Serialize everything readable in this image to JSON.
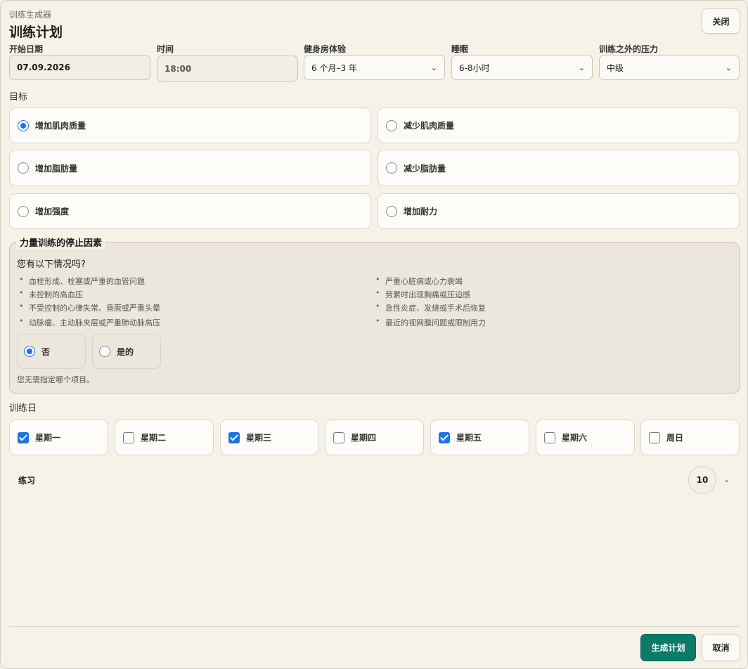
{
  "header": {
    "app_name": "训练生成器",
    "title": "训练计划",
    "close_label": "关闭"
  },
  "fields": {
    "start_date": {
      "label": "开始日期",
      "value": "07.09.2026"
    },
    "time": {
      "label": "时间",
      "value": "18:00"
    },
    "gym_experience": {
      "label": "健身房体验",
      "value": "6 个月–3 年"
    },
    "sleep": {
      "label": "睡眠",
      "value": "6-8小时"
    },
    "stress": {
      "label": "训练之外的压力",
      "value": "中级"
    }
  },
  "goals": {
    "label": "目标",
    "options": [
      {
        "label": "增加肌肉质量",
        "selected": true
      },
      {
        "label": "减少肌肉质量",
        "selected": false
      },
      {
        "label": "增加脂肪量",
        "selected": false
      },
      {
        "label": "减少脂肪量",
        "selected": false
      },
      {
        "label": "增加强度",
        "selected": false
      },
      {
        "label": "增加耐力",
        "selected": false
      }
    ]
  },
  "stop_factors": {
    "legend": "力量训练的停止因素",
    "question": "您有以下情况吗?",
    "conditions_left": [
      "血栓形成、栓塞或严重的血管问题",
      "未控制的高血压",
      "不受控制的心律失常、昏厥或严重头晕",
      "动脉瘤、主动脉夹层或严重肺动脉高压"
    ],
    "conditions_right": [
      "严重心脏病或心力衰竭",
      "劳累时出现胸痛或压迫感",
      "急性炎症、发烧或手术后恢复",
      "最近的视网膜问题或限制用力"
    ],
    "no_label": "否",
    "yes_label": "是的",
    "selected": "no",
    "hint": "您无需指定哪个项目。"
  },
  "training_days": {
    "label": "训练日",
    "days": [
      {
        "label": "星期一",
        "checked": true
      },
      {
        "label": "星期二",
        "checked": false
      },
      {
        "label": "星期三",
        "checked": true
      },
      {
        "label": "星期四",
        "checked": false
      },
      {
        "label": "星期五",
        "checked": true
      },
      {
        "label": "星期六",
        "checked": false
      },
      {
        "label": "周日",
        "checked": false
      }
    ]
  },
  "exercises": {
    "label": "练习",
    "count": "10"
  },
  "footer": {
    "generate_label": "生成计划",
    "cancel_label": "取消"
  },
  "colors": {
    "accent": "#1a73e8",
    "primary_button": "#0b7a68",
    "background": "#f5f2e8",
    "warning_border": "#e3b6ae"
  }
}
